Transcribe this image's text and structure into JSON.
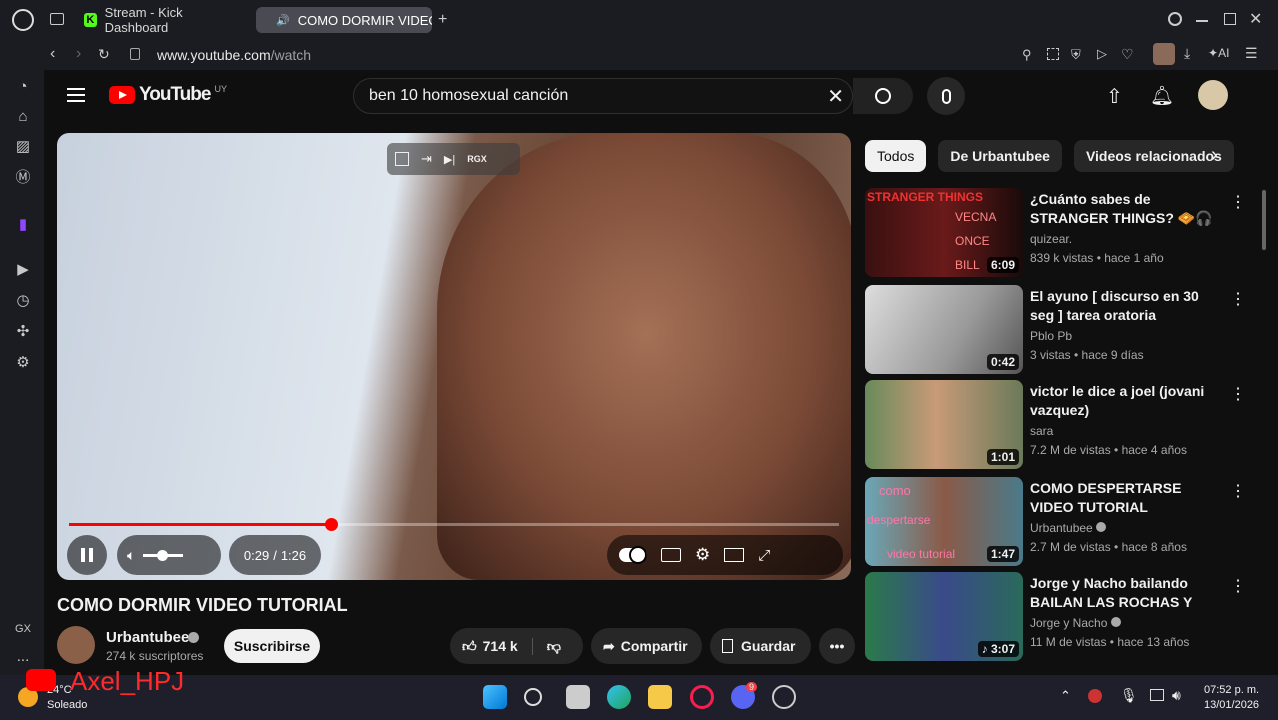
{
  "browser": {
    "tabs": [
      {
        "label": "Stream - Kick Dashboard"
      },
      {
        "label": "COMO DORMIR VIDEO"
      }
    ],
    "url_domain": "www.youtube.com",
    "url_path": "/watch",
    "ai_label": "AI"
  },
  "youtube": {
    "logo_text": "YouTube",
    "country": "UY",
    "search_value": "ben 10 homosexual canción"
  },
  "player": {
    "time_current": "0:29",
    "time_separator": "/",
    "time_total": "1:26",
    "progress_fraction": 0.34,
    "buffered_fraction": 0.92,
    "overlay_badge": "RGX"
  },
  "video": {
    "title": "COMO DORMIR VIDEO TUTORIAL",
    "channel": "Urbantubee",
    "subscribers": "274 k suscriptores",
    "subscribe_label": "Suscribirse",
    "likes": "714 k",
    "share_label": "Compartir",
    "save_label": "Guardar"
  },
  "chips": [
    {
      "label": "Todos"
    },
    {
      "label": "De Urbantubee"
    },
    {
      "label": "Videos relacionados"
    }
  ],
  "recommendations": [
    {
      "title": "¿Cuánto sabes de STRANGER THINGS? 🧇🎧🚲 Nivel ...",
      "channel": "quizear.",
      "meta": "839 k vistas • hace 1 año",
      "duration": "6:09",
      "thumb_labels": [
        "STRANGER THINGS",
        "VECNA",
        "ONCE",
        "BILL"
      ],
      "verified": false
    },
    {
      "title": "El ayuno [ discurso en 30 seg ] tarea oratoria",
      "channel": "Pblo Pb",
      "meta": "3 vistas • hace 9 días",
      "duration": "0:42",
      "verified": false
    },
    {
      "title": "victor le dice a joel (jovani vazquez)",
      "channel": "sara",
      "meta": "7.2 M de vistas • hace 4 años",
      "duration": "1:01",
      "verified": false
    },
    {
      "title": "COMO DESPERTARSE VIDEO TUTORIAL",
      "channel": "Urbantubee",
      "meta": "2.7 M de vistas • hace 8 años",
      "duration": "1:47",
      "thumb_labels": [
        "como",
        "despertarse",
        "video tutorial"
      ],
      "verified": true
    },
    {
      "title": "Jorge y Nacho bailando BAILAN LAS ROCHAS Y LAS CHETAS -...",
      "channel": "Jorge y Nacho",
      "meta": "11 M de vistas • hace 13 años",
      "duration": "3:07",
      "verified": true
    }
  ],
  "sidebar_left": {
    "gx_label": "GX",
    "more_label": "..."
  },
  "taskbar": {
    "weather_temp": "24°C",
    "weather_desc": "Soleado",
    "overlay_name": "Axel_HPJ",
    "time": "07:52 p. m.",
    "date": "13/01/2026",
    "discord_badge": "9"
  },
  "colors": {
    "accent_red": "#ff0000",
    "kick_green": "#53fc18",
    "twitch_purple": "#9146ff",
    "background": "#0f0f0f"
  }
}
